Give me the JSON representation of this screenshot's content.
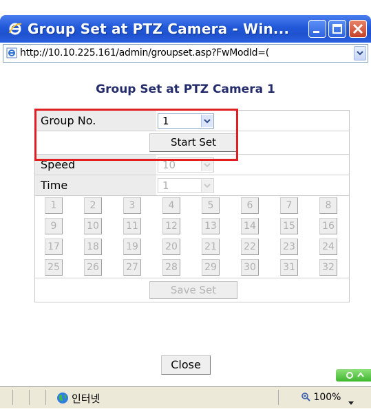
{
  "window": {
    "title": "Group Set at PTZ Camera - Win...",
    "url": "http://10.10.225.161/admin/groupset.asp?FwModId=("
  },
  "form": {
    "heading": "Group Set at PTZ Camera 1",
    "group_no_label": "Group No.",
    "group_no_value": "1",
    "start_set_label": "Start Set",
    "speed_label": "Speed",
    "speed_value": "10",
    "time_label": "Time",
    "time_value": "1",
    "preset_buttons": [
      "1",
      "2",
      "3",
      "4",
      "5",
      "6",
      "7",
      "8",
      "9",
      "10",
      "11",
      "12",
      "13",
      "14",
      "15",
      "16",
      "17",
      "18",
      "19",
      "20",
      "21",
      "22",
      "23",
      "24",
      "25",
      "26",
      "27",
      "28",
      "29",
      "30",
      "31",
      "32"
    ],
    "save_set_label": "Save Set",
    "close_label": "Close"
  },
  "status": {
    "zone": "인터넷",
    "zoom": "100%"
  },
  "colors": {
    "title_bar": "#2158d8",
    "heading": "#232b6b",
    "highlight_box": "#e02020"
  }
}
